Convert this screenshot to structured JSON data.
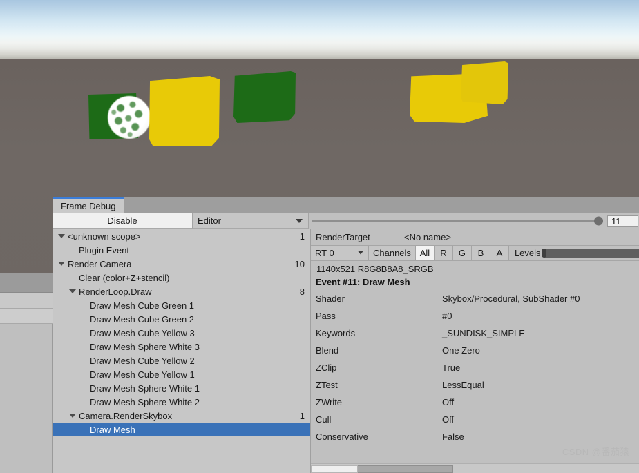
{
  "viewport": {
    "name": "unity-scene-view",
    "sky_top_color": "#a8c6e0",
    "sky_horizon_color": "#f2f4f2",
    "ground_color": "#6d6662",
    "objects": [
      {
        "name": "Cube Green 1",
        "color": "#1d6b17"
      },
      {
        "name": "Cube Yellow 1",
        "color": "#e8ca07"
      },
      {
        "name": "Cube Green 2",
        "color": "#1d6b17"
      },
      {
        "name": "Cube Yellow 2",
        "color": "#e8ca07"
      },
      {
        "name": "Cube Yellow 3",
        "color": "#e3c60a"
      },
      {
        "name": "Sphere White",
        "color": "#ffffff"
      }
    ]
  },
  "window": {
    "tab_label": "Frame Debug",
    "accent_color": "#3b7dd8"
  },
  "toolbar": {
    "disable_label": "Disable",
    "target_dropdown": "Editor",
    "event_index": "11"
  },
  "tree": {
    "rows": [
      {
        "label": "<unknown scope>",
        "indent": 0,
        "twisty": true,
        "count": "1",
        "selected": false
      },
      {
        "label": "Plugin Event",
        "indent": 1,
        "twisty": false,
        "count": "",
        "selected": false
      },
      {
        "label": "Render Camera",
        "indent": 0,
        "twisty": true,
        "count": "10",
        "selected": false
      },
      {
        "label": "Clear (color+Z+stencil)",
        "indent": 1,
        "twisty": false,
        "count": "",
        "selected": false
      },
      {
        "label": "RenderLoop.Draw",
        "indent": 1,
        "twisty": true,
        "count": "8",
        "selected": false
      },
      {
        "label": "Draw Mesh Cube Green 1",
        "indent": 2,
        "twisty": false,
        "count": "",
        "selected": false
      },
      {
        "label": "Draw Mesh Cube Green 2",
        "indent": 2,
        "twisty": false,
        "count": "",
        "selected": false
      },
      {
        "label": "Draw Mesh Cube Yellow 3",
        "indent": 2,
        "twisty": false,
        "count": "",
        "selected": false
      },
      {
        "label": "Draw Mesh Sphere White 3",
        "indent": 2,
        "twisty": false,
        "count": "",
        "selected": false
      },
      {
        "label": "Draw Mesh Cube Yellow 2",
        "indent": 2,
        "twisty": false,
        "count": "",
        "selected": false
      },
      {
        "label": "Draw Mesh Cube Yellow 1",
        "indent": 2,
        "twisty": false,
        "count": "",
        "selected": false
      },
      {
        "label": "Draw Mesh Sphere White 1",
        "indent": 2,
        "twisty": false,
        "count": "",
        "selected": false
      },
      {
        "label": "Draw Mesh Sphere White 2",
        "indent": 2,
        "twisty": false,
        "count": "",
        "selected": false
      },
      {
        "label": "Camera.RenderSkybox",
        "indent": 1,
        "twisty": true,
        "count": "1",
        "selected": false
      },
      {
        "label": "Draw Mesh",
        "indent": 2,
        "twisty": false,
        "count": "",
        "selected": true
      }
    ]
  },
  "details": {
    "render_target_label": "RenderTarget",
    "render_target_name": "<No name>",
    "rt_select": "RT 0",
    "channels_label": "Channels",
    "channel_buttons": [
      {
        "label": "All",
        "active": true
      },
      {
        "label": "R",
        "active": false
      },
      {
        "label": "G",
        "active": false
      },
      {
        "label": "B",
        "active": false
      },
      {
        "label": "A",
        "active": false
      }
    ],
    "levels_label": "Levels",
    "format": "1140x521 R8G8B8A8_SRGB",
    "event_title": "Event #11: Draw Mesh",
    "properties": [
      {
        "key": "Shader",
        "value": "Skybox/Procedural, SubShader #0"
      },
      {
        "key": "Pass",
        "value": "#0"
      },
      {
        "key": "Keywords",
        "value": "_SUNDISK_SIMPLE"
      },
      {
        "key": "Blend",
        "value": "One Zero"
      },
      {
        "key": "ZClip",
        "value": "True"
      },
      {
        "key": "ZTest",
        "value": "LessEqual"
      },
      {
        "key": "ZWrite",
        "value": "Off"
      },
      {
        "key": "Cull",
        "value": "Off"
      },
      {
        "key": "Conservative",
        "value": "False"
      }
    ]
  },
  "watermark": {
    "text": "CSDN @番茄猿"
  }
}
